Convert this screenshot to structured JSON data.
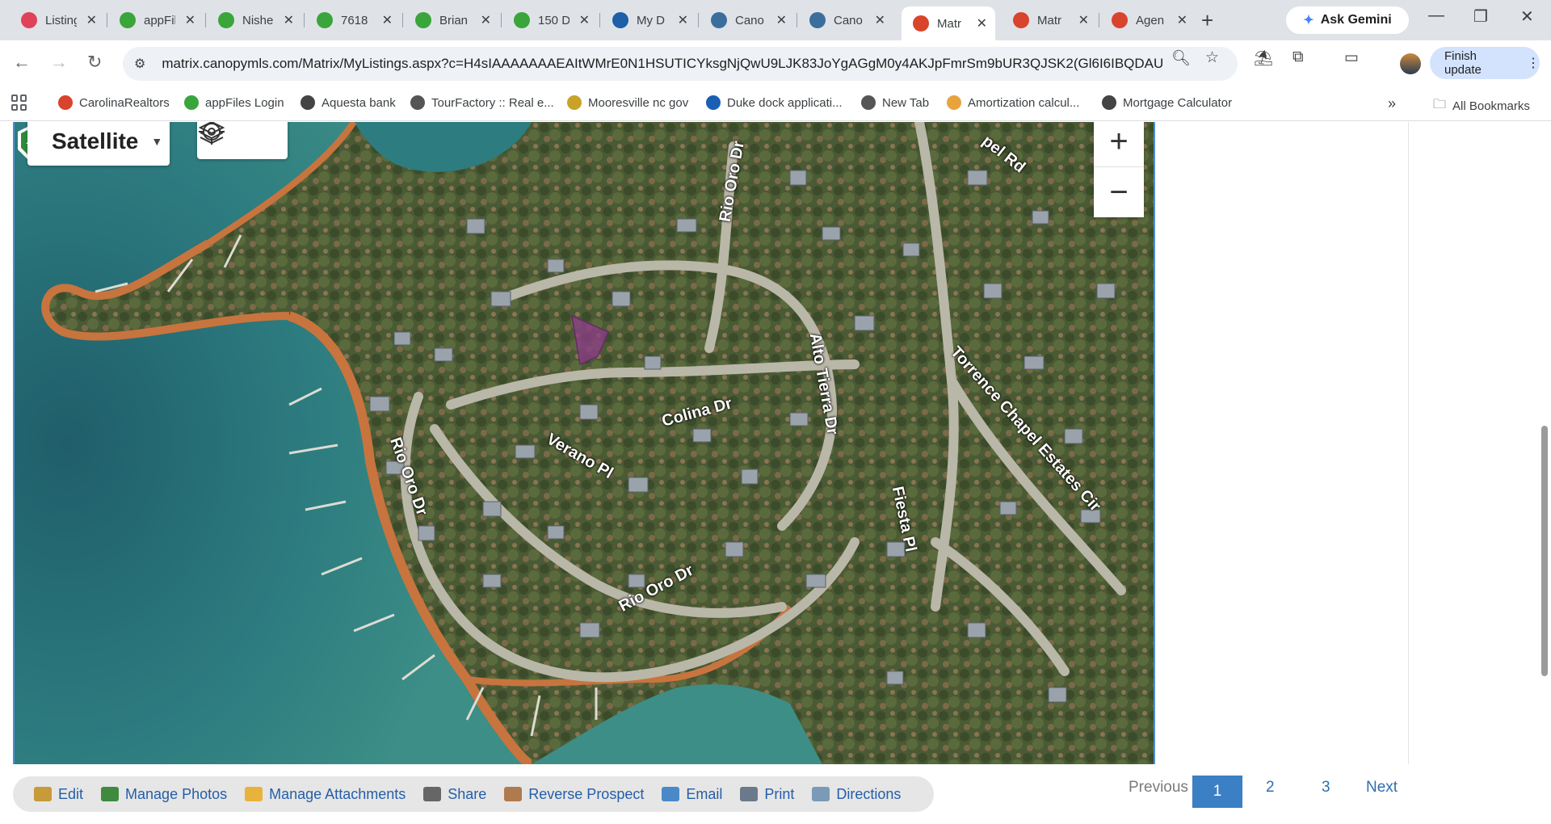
{
  "browser": {
    "tabs": [
      {
        "title": "Listings",
        "icon": "airbnb-like-icon",
        "color": "#e0425a"
      },
      {
        "title": "appFiles",
        "icon": "appfiles-icon",
        "color": "#3aa53a"
      },
      {
        "title": "Nishe",
        "icon": "appfiles-icon",
        "color": "#3aa53a"
      },
      {
        "title": "7618",
        "icon": "appfiles-icon",
        "color": "#3aa53a"
      },
      {
        "title": "Brian",
        "icon": "appfiles-icon",
        "color": "#3aa53a"
      },
      {
        "title": "150 D",
        "icon": "appfiles-icon",
        "color": "#3aa53a"
      },
      {
        "title": "My D",
        "icon": "docusign-icon",
        "color": "#1d5fa8"
      },
      {
        "title": "Cano",
        "icon": "canopy-icon",
        "color": "#3b6e9b"
      },
      {
        "title": "Cano",
        "icon": "canopy-icon",
        "color": "#3b6e9b"
      },
      {
        "title": "Matr",
        "icon": "matrix-icon",
        "color": "#d9442c",
        "active": true
      },
      {
        "title": "Matr",
        "icon": "matrix-icon",
        "color": "#d9442c"
      },
      {
        "title": "Agen",
        "icon": "matrix-icon",
        "color": "#d9442c"
      }
    ],
    "new_tab": "+",
    "gemini_label": "Ask Gemini",
    "url": "matrix.canopymls.com/Matrix/MyListings.aspx?c=H4sIAAAAAAAEAItWMrE0N1HSUTICYksgNjQwU9LJK83JoYgAGgM0y4AKJpFmrSm9bUR3QJSK2(Gl6I6IBQDAU...",
    "finish_update": "Finish update"
  },
  "bookmarks": [
    {
      "label": "CarolinaRealtors",
      "color": "#d9442c"
    },
    {
      "label": "appFiles Login",
      "color": "#3aa53a"
    },
    {
      "label": "Aquesta bank",
      "color": "#444444"
    },
    {
      "label": "TourFactory :: Real e...",
      "color": "#555555"
    },
    {
      "label": "Mooresville nc gov",
      "color": "#c9a227"
    },
    {
      "label": "Duke dock applicati...",
      "color": "#1a5fb4"
    },
    {
      "label": "New Tab",
      "color": "#555555"
    },
    {
      "label": "Amortization calcul...",
      "color": "#e8a33d"
    },
    {
      "label": "Mortgage Calculator",
      "color": "#444444"
    }
  ],
  "bookmarks_more": "»",
  "all_bookmarks": "All Bookmarks",
  "map": {
    "type_label": "Satellite",
    "zoom_in": "+",
    "zoom_out": "−",
    "streets": [
      {
        "name": "Rio Oro Dr"
      },
      {
        "name": "Alto Tierra Dr"
      },
      {
        "name": "Colina Dr"
      },
      {
        "name": "Verano Pl"
      },
      {
        "name": "Rio Oro Dr"
      },
      {
        "name": "Fiesta Pl"
      },
      {
        "name": "Torrence Chapel Estates Cir"
      },
      {
        "name": "Rio Oro Dr"
      },
      {
        "name": "pel Rd"
      }
    ]
  },
  "actions": [
    {
      "label": "Edit",
      "icon": "edit-icon",
      "color": "#c79a3a"
    },
    {
      "label": "Manage Photos",
      "icon": "photos-icon",
      "color": "#3f8a3f"
    },
    {
      "label": "Manage Attachments",
      "icon": "folder-icon",
      "color": "#e8b23d"
    },
    {
      "label": "Share",
      "icon": "share-icon",
      "color": "#666666"
    },
    {
      "label": "Reverse Prospect",
      "icon": "person-icon",
      "color": "#b07a4f"
    },
    {
      "label": "Email",
      "icon": "email-icon",
      "color": "#4a88c8"
    },
    {
      "label": "Print",
      "icon": "print-icon",
      "color": "#6a7a8a"
    },
    {
      "label": "Directions",
      "icon": "compass-icon",
      "color": "#7a9ab8"
    }
  ],
  "pager": {
    "previous": "Previous",
    "pages": [
      "1",
      "2",
      "3"
    ],
    "current": "1",
    "next": "Next"
  }
}
